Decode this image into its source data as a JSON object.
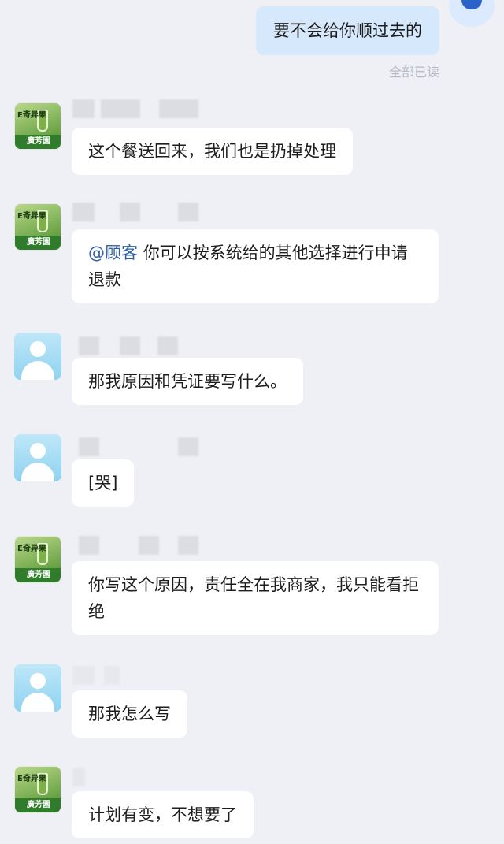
{
  "outgoing": {
    "text": "要不会给你顺过去的",
    "status": "全部已读"
  },
  "shop": {
    "logo_text": "E奇异果",
    "avatar_name": "廣芳園"
  },
  "messages": [
    {
      "text": "这个餐送回来，我们也是扔掉处理"
    },
    {
      "mention": "@顾客",
      "text": "你可以按系统给的其他选择进行申请退款"
    },
    {
      "text": "那我原因和凭证要写什么。"
    },
    {
      "text": "[哭]"
    },
    {
      "text": "你写这个原因，责任全在我商家，我只能看拒绝"
    },
    {
      "text": "那我怎么写"
    },
    {
      "text": "计划有变，不想要了"
    }
  ]
}
